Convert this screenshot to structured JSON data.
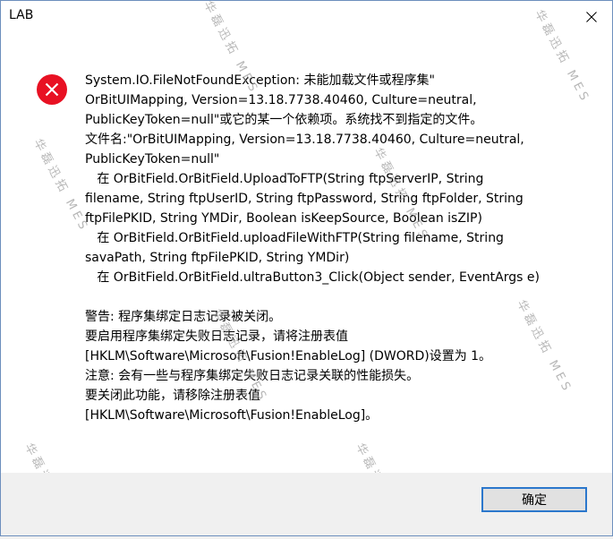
{
  "window": {
    "title": "LAB"
  },
  "dialog": {
    "message_lines": [
      "System.IO.FileNotFoundException: 未能加载文件或程序集\"",
      "OrBitUIMapping, Version=13.18.7738.40460, Culture=neutral,",
      "PublicKeyToken=null\"或它的某一个依赖项。系统找不到指定的文件。",
      "文件名:\"OrBitUIMapping, Version=13.18.7738.40460, Culture=neutral,",
      "PublicKeyToken=null\"",
      "   在 OrBitField.OrBitField.UploadToFTP(String ftpServerIP, String",
      "filename, String ftpUserID, String ftpPassword, String ftpFolder, String",
      "ftpFilePKID, String YMDir, Boolean isKeepSource, Boolean isZIP)",
      "   在 OrBitField.OrBitField.uploadFileWithFTP(String filename, String",
      "savaPath, String ftpFilePKID, String YMDir)",
      "   在 OrBitField.OrBitField.ultraButton3_Click(Object sender, EventArgs e)",
      "",
      "警告: 程序集绑定日志记录被关闭。",
      "要启用程序集绑定失败日志记录，请将注册表值",
      "[HKLM\\Software\\Microsoft\\Fusion!EnableLog] (DWORD)设置为 1。",
      "注意: 会有一些与程序集绑定失败日志记录关联的性能损失。",
      "要关闭此功能，请移除注册表值",
      "[HKLM\\Software\\Microsoft\\Fusion!EnableLog]。"
    ],
    "ok_label": "确定",
    "icon": "error-icon"
  },
  "watermark": {
    "text": "华磊迅拓 MES"
  },
  "colors": {
    "error_red": "#e81123",
    "button_border": "#2b77cc",
    "footer_bg": "#f0f0f0"
  }
}
